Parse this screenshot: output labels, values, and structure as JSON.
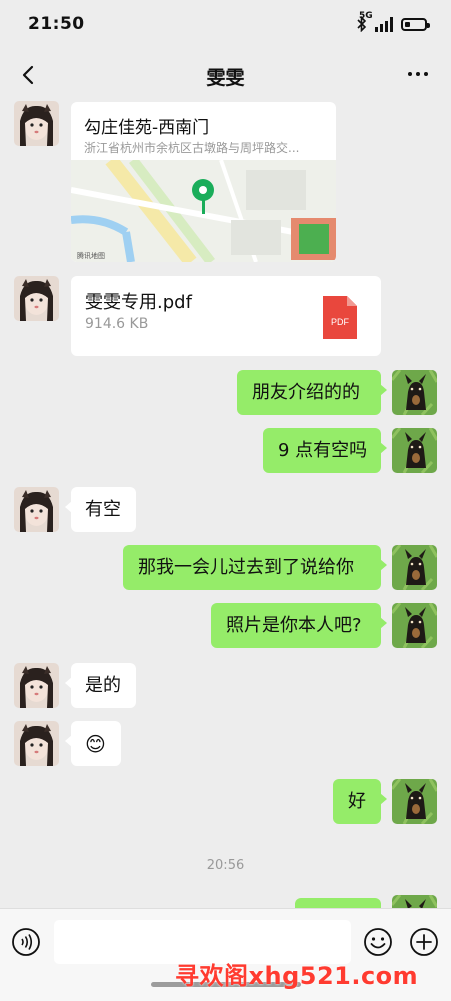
{
  "status": {
    "time": "21:50",
    "network": "5G",
    "battery_level": 0.3
  },
  "nav": {
    "title": "雯雯"
  },
  "messages": {
    "location": {
      "title": "勾庄佳苑-西南门",
      "address": "浙江省杭州市余杭区古墩路与周坪路交...",
      "map_label": "腾讯地图"
    },
    "file": {
      "name": "雯雯专用.pdf",
      "size": "914.6 KB",
      "type_label": "PDF"
    },
    "m1": "朋友介绍的的",
    "m2": "9 点有空吗",
    "m3": "有空",
    "m4": "那我一会儿过去到了说给你",
    "m5": "照片是你本人吧?",
    "m6": "是的",
    "m7": "😊",
    "m8": "好"
  },
  "timestamp": "20:56",
  "watermark": "寻欢阁xhg521.com",
  "colors": {
    "outgoing_bubble": "#95ec69",
    "incoming_bubble": "#ffffff",
    "background": "#ededed",
    "pin": "#1aad5a"
  }
}
